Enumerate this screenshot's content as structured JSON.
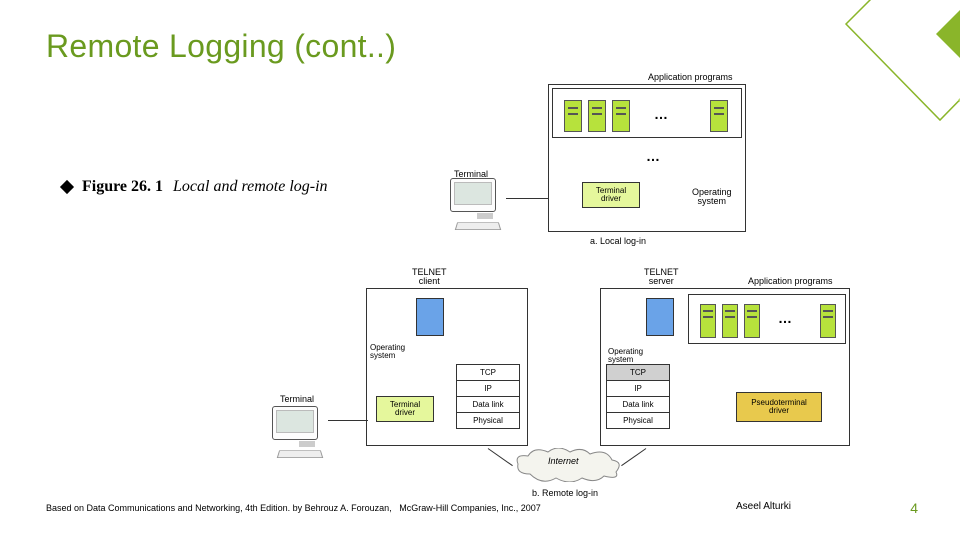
{
  "title": "Remote Logging (cont..)",
  "bullet": {
    "figure_num": "Figure 26. 1",
    "figure_title": "Local and remote log-in"
  },
  "figure_a": {
    "app_label": "Application programs",
    "terminal_label": "Terminal",
    "terminal_driver": "Terminal\ndriver",
    "os_label": "Operating\nsystem",
    "caption": "a. Local log-in"
  },
  "figure_b": {
    "caption": "b. Remote log-in",
    "terminal_label": "Terminal",
    "client": {
      "top_label": "TELNET\nclient",
      "os_label": "Operating\nsystem",
      "terminal_driver": "Terminal\ndriver",
      "stack": [
        "TCP",
        "IP",
        "Data link",
        "Physical"
      ]
    },
    "server": {
      "top_label1": "TELNET\nserver",
      "top_label2": "Application programs",
      "os_label": "Operating\nsystem",
      "stack": [
        "TCP",
        "IP",
        "Data link",
        "Physical"
      ],
      "pseudo": "Pseudoterminal\ndriver"
    },
    "internet_label": "Internet"
  },
  "footer": {
    "source": "Based on Data Communications and Networking, 4th Edition. by Behrouz A. Forouzan,   McGraw-Hill Companies, Inc., 2007",
    "author": "Aseel Alturki",
    "page": "4"
  }
}
